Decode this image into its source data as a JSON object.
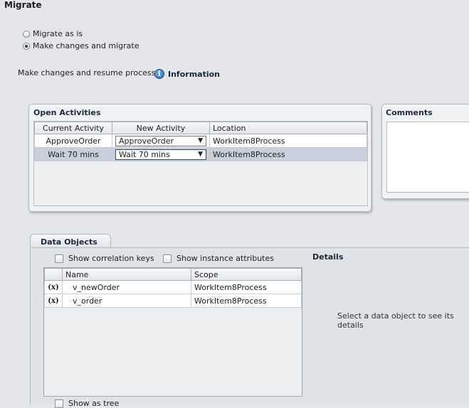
{
  "page": {
    "title": "Migrate"
  },
  "migration_options": [
    {
      "label": "Migrate as is",
      "selected": false
    },
    {
      "label": "Make changes and migrate",
      "selected": true
    }
  ],
  "resume": {
    "label": "Make changes and resume process"
  },
  "info": {
    "icon": "info-icon",
    "label": "Information"
  },
  "open_activities": {
    "title": "Open Activities",
    "columns": [
      "Current Activity",
      "New Activity",
      "Location"
    ],
    "rows": [
      {
        "current": "ApproveOrder",
        "new": "ApproveOrder",
        "location": "WorkItem8Process",
        "selected": false
      },
      {
        "current": "Wait 70 mins",
        "new": "Wait 70 mins",
        "location": "WorkItem8Process",
        "selected": true
      }
    ]
  },
  "comments": {
    "title": "Comments"
  },
  "data_objects": {
    "tab_label": "Data Objects",
    "show_correlation_keys": "Show correlation keys",
    "show_instance_attributes": "Show instance attributes",
    "columns": [
      "Name",
      "Scope"
    ],
    "rows": [
      {
        "icon": "(x)",
        "name": "v_newOrder",
        "scope": "WorkItem8Process"
      },
      {
        "icon": "(x)",
        "name": "v_order",
        "scope": "WorkItem8Process"
      }
    ],
    "show_as_tree": "Show as tree"
  },
  "details": {
    "title": "Details",
    "placeholder": "Select a data object to see its details"
  }
}
